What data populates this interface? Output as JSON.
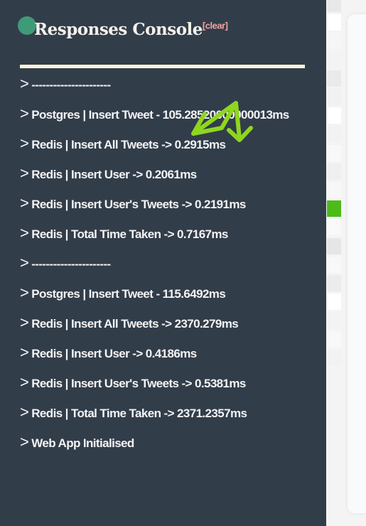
{
  "console": {
    "title": "Responses Console",
    "clear_label": "[clear]",
    "lines": [
      "----------------------",
      "Postgres | Insert Tweet - 105.28520000000013ms",
      "Redis | Insert All Tweets -> 0.2915ms",
      "Redis | Insert User -> 0.2061ms",
      "Redis | Insert User's Tweets -> 0.2191ms",
      "Redis | Total Time Taken -> 0.7167ms",
      "----------------------",
      "Postgres | Insert Tweet - 115.6492ms",
      "Redis | Insert All Tweets -> 2370.279ms",
      "Redis | Insert User -> 0.4186ms",
      "Redis | Insert User's Tweets -> 0.5381ms",
      "Redis | Total Time Taken -> 2371.2357ms",
      "Web App Initialised"
    ],
    "prompt": ">"
  },
  "colors": {
    "background": "#323d4a",
    "accent": "#3f9a78",
    "clear": "#f0a3a3",
    "annotation": "#8fd61f",
    "highlight_cell": "#4cbb17"
  }
}
